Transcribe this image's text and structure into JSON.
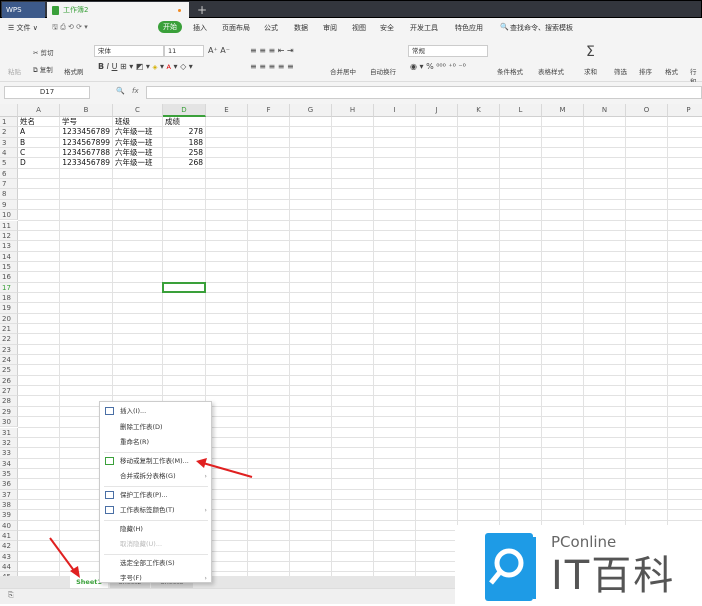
{
  "titlebar": {
    "app": "WPS",
    "doc_tab": "工作簿2",
    "new_tab": "+"
  },
  "menubar": {
    "file": "☰ 文件 ∨",
    "items": [
      "开始",
      "插入",
      "页面布局",
      "公式",
      "数据",
      "审阅",
      "视图",
      "安全",
      "开发工具",
      "特色应用"
    ],
    "search": "查找命令、搜索模板"
  },
  "toolbar": {
    "paste": "粘贴",
    "cut": "剪切",
    "copy": "复制",
    "format_painter": "格式刷",
    "font": "宋体",
    "size": "11",
    "merge": "合并居中",
    "wrap": "自动换行",
    "number_format": "常规",
    "cond_format": "条件格式",
    "table_style": "表格样式",
    "sum": "求和",
    "filter": "筛选",
    "sort": "排序",
    "format": "格式",
    "rowcol": "行和"
  },
  "formula": {
    "cell_ref": "D17",
    "fx": "fx",
    "value": ""
  },
  "columns": [
    "A",
    "B",
    "C",
    "D",
    "E",
    "F",
    "G",
    "H",
    "I",
    "J",
    "K",
    "L",
    "M",
    "N",
    "O",
    "P"
  ],
  "active_cell": "D17",
  "table": {
    "headers": [
      "姓名",
      "学号",
      "班级",
      "成绩"
    ],
    "rows": [
      [
        "A",
        "1233456789",
        "六年级一班",
        "278"
      ],
      [
        "B",
        "1234567899",
        "六年级一班",
        "188"
      ],
      [
        "C",
        "1234567788",
        "六年级一班",
        "258"
      ],
      [
        "D",
        "1233456789",
        "六年级一班",
        "268"
      ]
    ]
  },
  "sheets": [
    "Sheet1",
    "Sheet2",
    "Sheet3"
  ],
  "active_sheet": "Sheet1",
  "context_menu": {
    "items": [
      {
        "label": "插入(I)...",
        "icon": "insert-icon"
      },
      {
        "label": "删除工作表(D)"
      },
      {
        "label": "重命名(R)"
      },
      {
        "label": "移动或复制工作表(M)...",
        "icon": "move-copy-icon"
      },
      {
        "label": "合并或拆分表格(G)",
        "submenu": true
      },
      {
        "label": "保护工作表(P)...",
        "icon": "protect-icon"
      },
      {
        "label": "工作表标签颜色(T)",
        "icon": "tab-color-icon",
        "submenu": true
      },
      {
        "label": "隐藏(H)"
      },
      {
        "label": "取消隐藏(U)...",
        "disabled": true
      },
      {
        "label": "选定全部工作表(S)"
      },
      {
        "label": "字号(F)",
        "submenu": true
      }
    ]
  },
  "watermark": {
    "brand": "PConline",
    "name": "IT百科"
  },
  "colors": {
    "accent": "#3aa03a",
    "arrow": "#e02020",
    "logo": "#1e9be6"
  }
}
